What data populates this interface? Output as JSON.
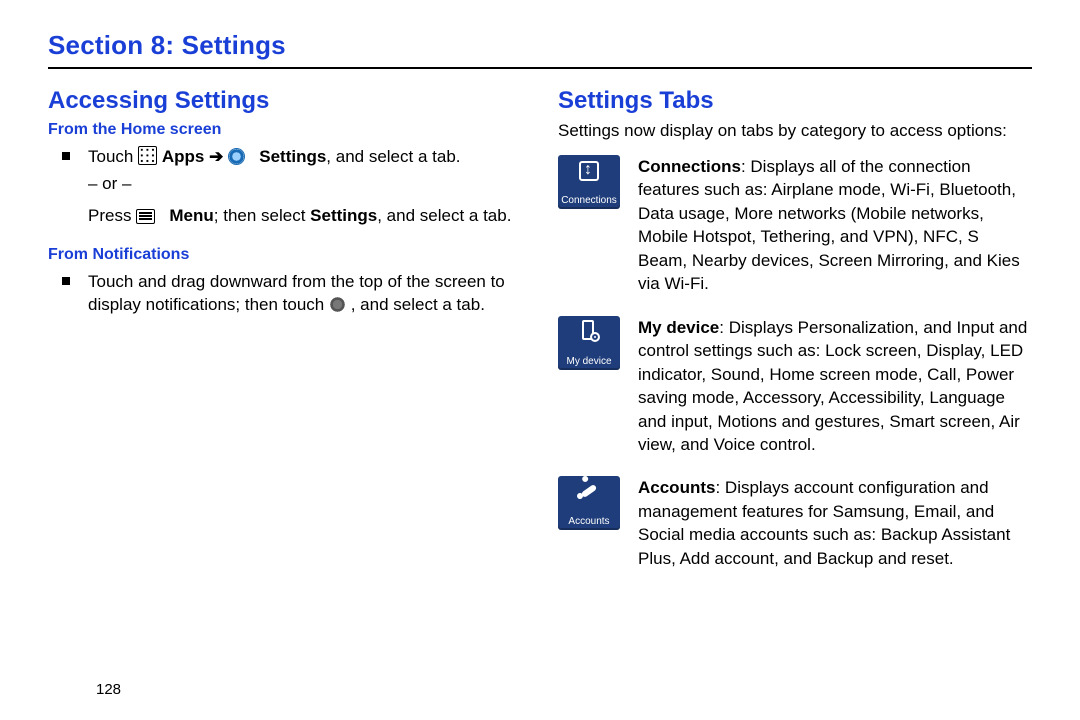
{
  "section_title": "Section 8: Settings",
  "page_number": "128",
  "left": {
    "heading": "Accessing Settings",
    "sub1": "From the Home screen",
    "line1_a": "Touch ",
    "line1_apps": "Apps",
    "line1_arrow": " ➔ ",
    "line1_settings": "Settings",
    "line1_b": ", and select a tab.",
    "or": "– or –",
    "line2_a": "Press ",
    "line2_menu": "Menu",
    "line2_b": "; then select ",
    "line2_settings": "Settings",
    "line2_c": ", and select a tab.",
    "sub2": "From Notifications",
    "line3_a": "Touch and drag downward from the top of the screen to display notifications; then touch ",
    "line3_b": ", and select a tab."
  },
  "right": {
    "heading": "Settings Tabs",
    "intro": "Settings now display on tabs by category to access options:",
    "tabs": [
      {
        "badge": "Connections",
        "title": "Connections",
        "text": ": Displays all of the connection features such as: Airplane mode, Wi-Fi, Bluetooth, Data usage, More networks (Mobile networks, Mobile Hotspot, Tethering, and VPN), NFC, S Beam, Nearby devices, Screen Mirroring, and Kies via Wi-Fi."
      },
      {
        "badge": "My device",
        "title": "My device",
        "text": ": Displays Personalization, and Input and control settings such as: Lock screen, Display, LED indicator, Sound, Home screen mode, Call, Power saving mode, Accessory, Accessibility, Language and input, Motions and gestures, Smart screen, Air view, and Voice control."
      },
      {
        "badge": "Accounts",
        "title": "Accounts",
        "text": ": Displays account configuration and management features for Samsung, Email, and Social media accounts such as: Backup Assistant Plus, Add account, and Backup and reset."
      }
    ]
  }
}
